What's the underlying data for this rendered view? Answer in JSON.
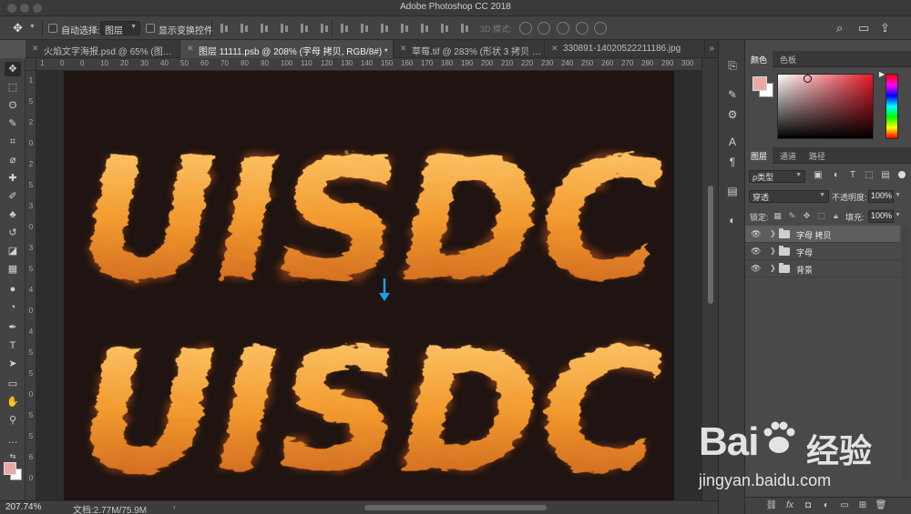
{
  "window": {
    "title": "Adobe Photoshop CC 2018"
  },
  "options_bar": {
    "auto_select_label": "自动选择:",
    "auto_select_value": "图层",
    "show_transform_label": "显示变换控件",
    "mode_3d_label": "3D 模式:"
  },
  "tabs": [
    {
      "label": "火焰文字海报.psd @ 65% (图…",
      "active": false
    },
    {
      "label": "图层 11111.psb @ 208% (字母 拷贝, RGB/8#) *",
      "active": true
    },
    {
      "label": "草莓.tif @ 283% (形状 3 拷贝 …",
      "active": false
    },
    {
      "label": "330891-14020522211186.jpg",
      "active": false
    }
  ],
  "tabs_more": "»",
  "ruler_top": [
    "1",
    "0",
    "0",
    "10",
    "20",
    "30",
    "40",
    "50",
    "60",
    "70",
    "80",
    "90",
    "100",
    "110",
    "120",
    "130",
    "140",
    "150",
    "160",
    "170",
    "180",
    "190",
    "200",
    "210",
    "220",
    "230",
    "240",
    "250",
    "260",
    "270",
    "280",
    "290",
    "300"
  ],
  "ruler_left": [
    "1",
    "5",
    "2",
    "0",
    "2",
    "5",
    "3",
    "0",
    "3",
    "5",
    "4",
    "0",
    "4",
    "5",
    "5",
    "0",
    "5",
    "5",
    "6",
    "0"
  ],
  "canvas": {
    "text_top": "UISDC",
    "text_bottom": "UISDC",
    "flame_colors": [
      "#ffd27a",
      "#f29a2e",
      "#c2551a"
    ],
    "arrow_color": "#1e9ee6"
  },
  "status_bar": {
    "zoom": "207.74%",
    "doc": "文档:2.77M/75.9M",
    "arrow": "›"
  },
  "color_panel": {
    "tabs": [
      "颜色",
      "色板"
    ],
    "fg_color": "#e9a9a6",
    "bg_color": "#ffffff"
  },
  "layers_panel": {
    "tabs": [
      "图层",
      "通道",
      "路径"
    ],
    "filter_kind": "ρ类型",
    "blend_mode": "穿透",
    "opacity_label": "不透明度:",
    "opacity_value": "100%",
    "lock_label": "锁定:",
    "fill_label": "填充:",
    "fill_value": "100%",
    "layers": [
      {
        "name": "字母 拷贝",
        "selected": true
      },
      {
        "name": "字母",
        "selected": false
      },
      {
        "name": "背景",
        "selected": false
      }
    ]
  },
  "watermark": {
    "brand": "Bai",
    "brand2": "du",
    "cn": "经验",
    "url": "jingyan.baidu.com"
  }
}
